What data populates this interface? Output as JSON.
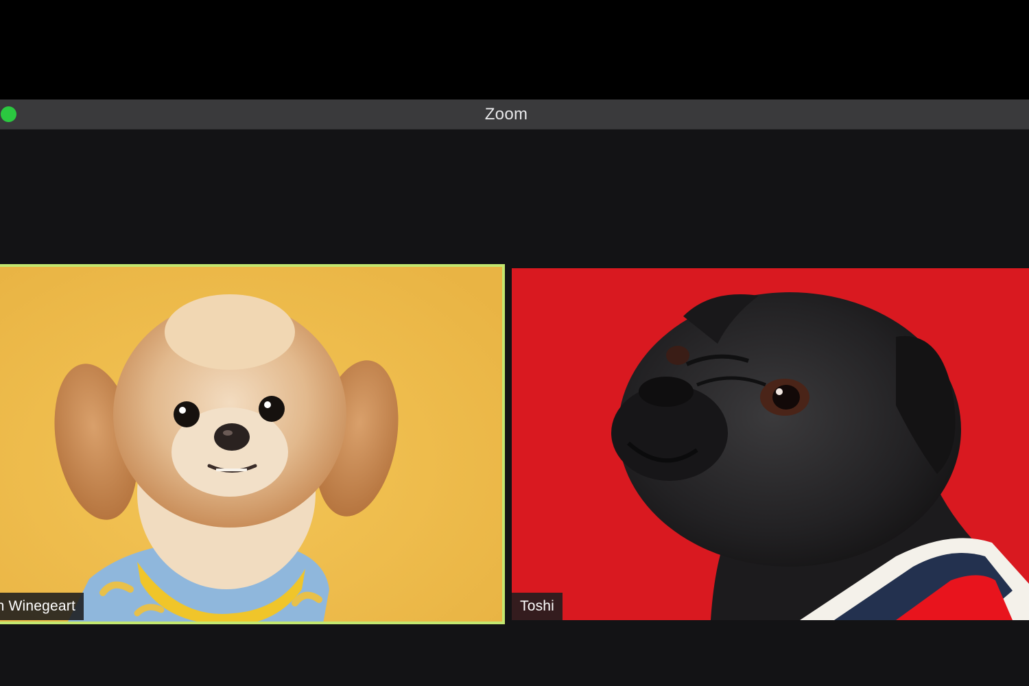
{
  "window": {
    "title": "Zoom",
    "accent_color": "#2bc840"
  },
  "meeting": {
    "active_speaker_border_color": "#c3e76f",
    "participants": [
      {
        "name": "n Winegeart",
        "video": "small-fluffy-dog-on-yellow-background",
        "background_color": "#f0bf4c",
        "active_speaker": true
      },
      {
        "name": "Toshi",
        "video": "black-pug-on-red-background",
        "background_color": "#d91920",
        "active_speaker": false
      }
    ]
  }
}
